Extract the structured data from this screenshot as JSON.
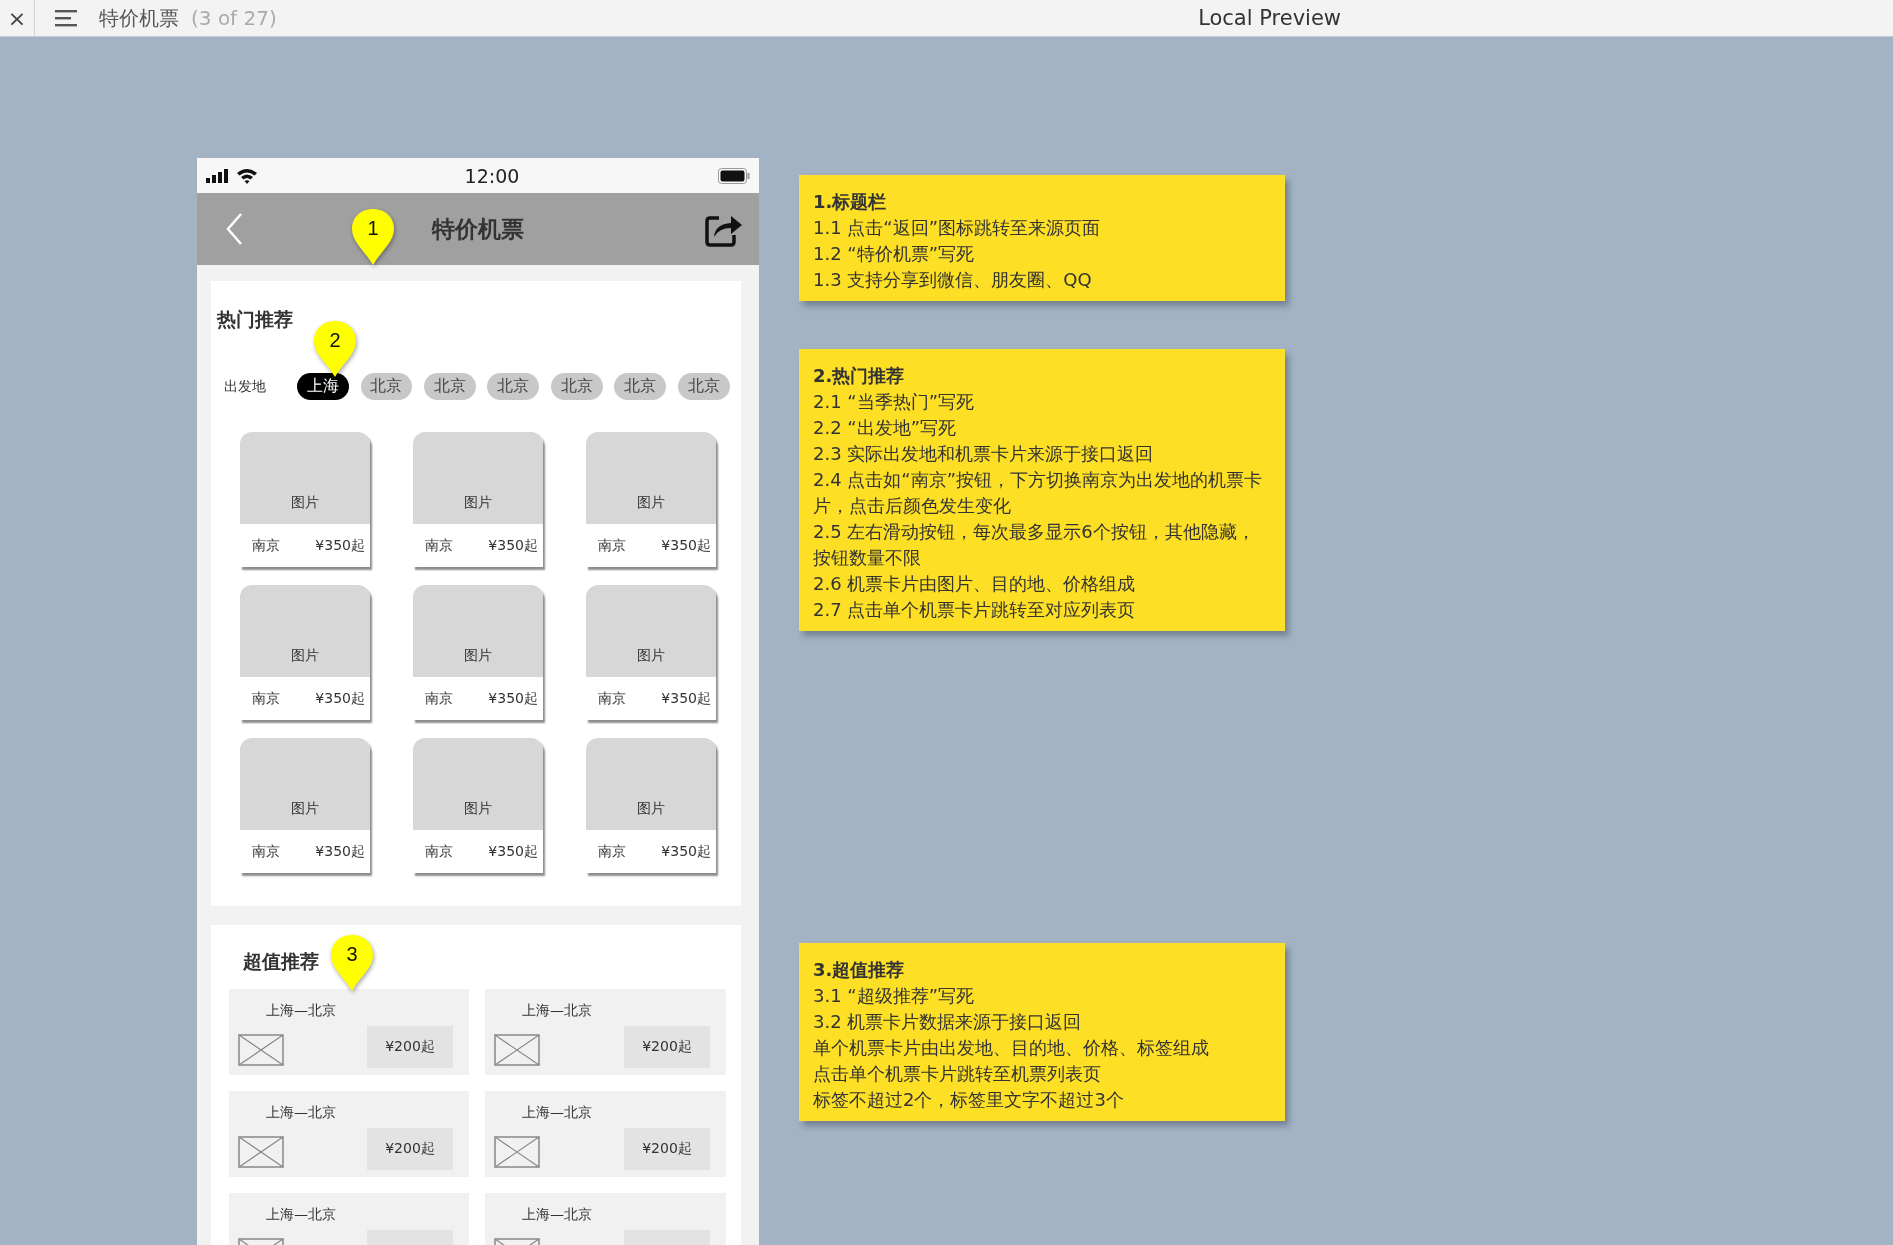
{
  "app_bar": {
    "close_glyph": "×",
    "title": "特价机票",
    "counter": "(3 of 27)",
    "preview_label": "Local Preview"
  },
  "phone": {
    "status_time": "12:00",
    "nav": {
      "title": "特价机票",
      "marker": "1"
    },
    "hot": {
      "title": "热门推荐",
      "marker": "2",
      "origin_label": "出发地",
      "origins": [
        {
          "label": "上海",
          "selected": true
        },
        {
          "label": "北京",
          "selected": false
        },
        {
          "label": "北京",
          "selected": false
        },
        {
          "label": "北京",
          "selected": false
        },
        {
          "label": "北京",
          "selected": false
        },
        {
          "label": "北京",
          "selected": false
        },
        {
          "label": "北京",
          "selected": false
        }
      ],
      "tickets": [
        {
          "image_label": "图片",
          "destination": "南京",
          "price": "¥350起"
        },
        {
          "image_label": "图片",
          "destination": "南京",
          "price": "¥350起"
        },
        {
          "image_label": "图片",
          "destination": "南京",
          "price": "¥350起"
        },
        {
          "image_label": "图片",
          "destination": "南京",
          "price": "¥350起"
        },
        {
          "image_label": "图片",
          "destination": "南京",
          "price": "¥350起"
        },
        {
          "image_label": "图片",
          "destination": "南京",
          "price": "¥350起"
        },
        {
          "image_label": "图片",
          "destination": "南京",
          "price": "¥350起"
        },
        {
          "image_label": "图片",
          "destination": "南京",
          "price": "¥350起"
        },
        {
          "image_label": "图片",
          "destination": "南京",
          "price": "¥350起"
        }
      ]
    },
    "value": {
      "title": "超值推荐",
      "marker": "3",
      "tickets": [
        {
          "route": "上海—北京",
          "price": "¥200起"
        },
        {
          "route": "上海—北京",
          "price": "¥200起"
        },
        {
          "route": "上海—北京",
          "price": "¥200起"
        },
        {
          "route": "上海—北京",
          "price": "¥200起"
        },
        {
          "route": "上海—北京"
        },
        {
          "route": "上海—北京"
        }
      ]
    }
  },
  "notes": [
    {
      "title": "1.标题栏",
      "lines": [
        "1.1 点击“返回”图标跳转至来源页面",
        "1.2 “特价机票”写死",
        "1.3 支持分享到微信、朋友圈、QQ"
      ]
    },
    {
      "title": "2.热门推荐",
      "lines": [
        "2.1 “当季热门”写死",
        "2.2 “出发地”写死",
        "2.3  实际出发地和机票卡片来源于接口返回",
        "2.4  点击如“南京”按钮，下方切换南京为出发地的机票卡片，点击后颜色发生变化",
        "2.5  左右滑动按钮，每次最多显示6个按钮，其他隐藏，按钮数量不限",
        "2.6  机票卡片由图片、目的地、价格组成",
        "2.7 点击单个机票卡片跳转至对应列表页"
      ]
    },
    {
      "title": "3.超值推荐",
      "lines": [
        "3.1 “超级推荐”写死",
        "3.2  机票卡片数据来源于接口返回",
        "单个机票卡片由出发地、目的地、价格、标签组成",
        "点击单个机票卡片跳转至机票列表页",
        "标签不超过2个，标签里文字不超过3个"
      ]
    }
  ]
}
